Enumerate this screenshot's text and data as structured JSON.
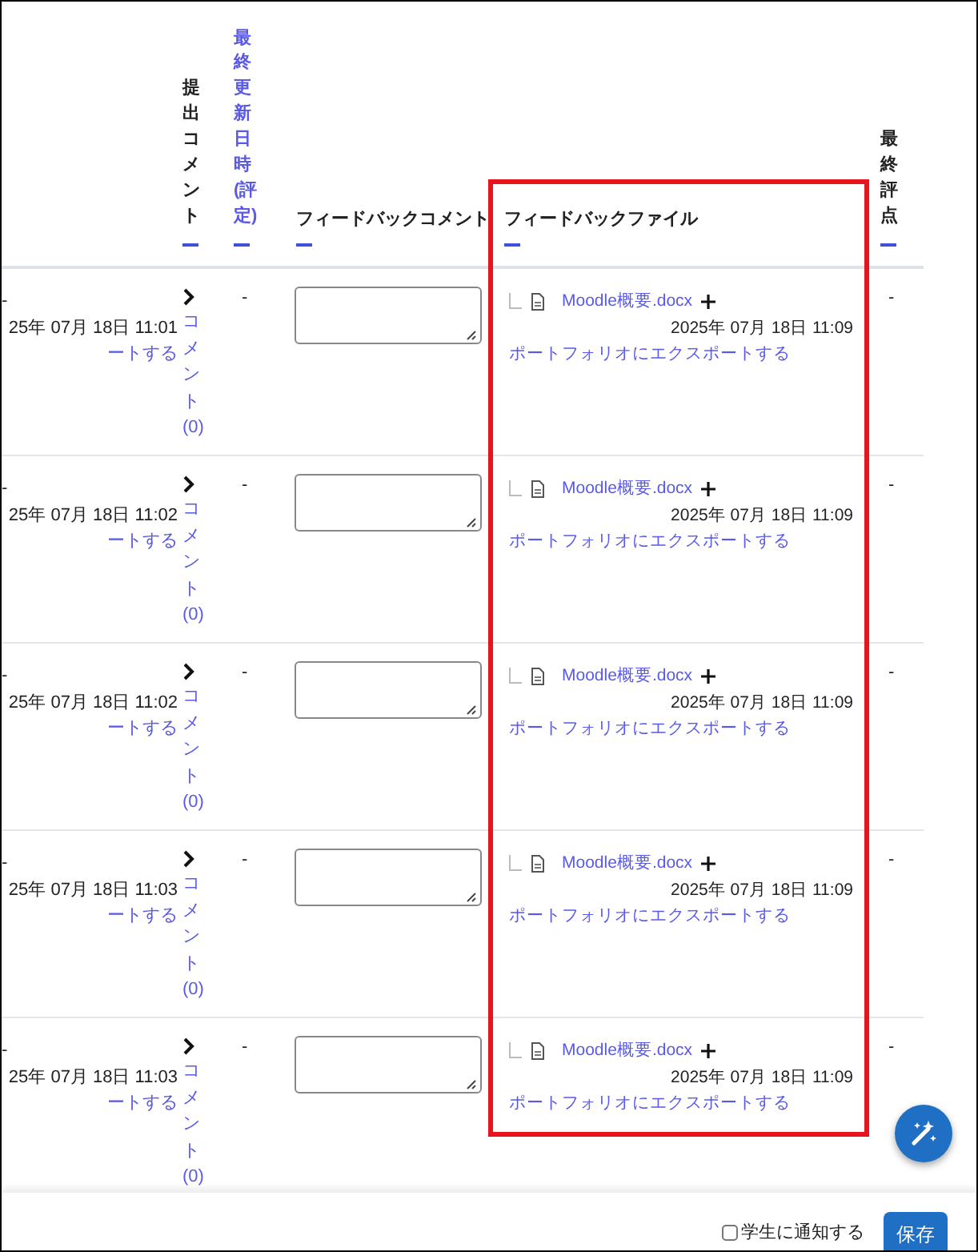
{
  "table": {
    "columns": [
      {
        "label": "提出コメント",
        "kind": "vertical",
        "link": false
      },
      {
        "label": "最終更新日時(評定)",
        "kind": "vertical",
        "link": true
      },
      {
        "label": "フィードバックコメント",
        "kind": "horizontal",
        "link": false
      },
      {
        "label": "フィードバックファイル",
        "kind": "horizontal",
        "link": false
      },
      {
        "label": "最終評点",
        "kind": "vertical",
        "link": false
      }
    ],
    "rows": [
      {
        "column_1": {
          "mark": "-",
          "date": "25年 07月 18日 11:01",
          "link": "ートする"
        },
        "comment": {
          "label": "コメント",
          "count": "(0)"
        },
        "modified": "-",
        "feedback_file": {
          "name": "Moodle概要.docx",
          "date": "2025年 07月 18日 11:09",
          "export": "ポートフォリオにエクスポートする"
        },
        "grade": "-"
      },
      {
        "column_1": {
          "mark": "-",
          "date": "25年 07月 18日 11:02",
          "link": "ートする"
        },
        "comment": {
          "label": "コメント",
          "count": "(0)"
        },
        "modified": "-",
        "feedback_file": {
          "name": "Moodle概要.docx",
          "date": "2025年 07月 18日 11:09",
          "export": "ポートフォリオにエクスポートする"
        },
        "grade": "-"
      },
      {
        "column_1": {
          "mark": "-",
          "date": "25年 07月 18日 11:02",
          "link": "ートする"
        },
        "comment": {
          "label": "コメント",
          "count": "(0)"
        },
        "modified": "-",
        "feedback_file": {
          "name": "Moodle概要.docx",
          "date": "2025年 07月 18日 11:09",
          "export": "ポートフォリオにエクスポートする"
        },
        "grade": "-"
      },
      {
        "column_1": {
          "mark": "-",
          "date": "25年 07月 18日 11:03",
          "link": "ートする"
        },
        "comment": {
          "label": "コメント",
          "count": "(0)"
        },
        "modified": "-",
        "feedback_file": {
          "name": "Moodle概要.docx",
          "date": "2025年 07月 18日 11:09",
          "export": "ポートフォリオにエクスポートする"
        },
        "grade": "-"
      },
      {
        "column_1": {
          "mark": "-",
          "date": "25年 07月 18日 11:03",
          "link": "ートする"
        },
        "comment": {
          "label": "コメント",
          "count": "(0)"
        },
        "modified": "-",
        "feedback_file": {
          "name": "Moodle概要.docx",
          "date": "2025年 07月 18日 11:09",
          "export": "ポートフォリオにエクスポートする"
        },
        "grade": "-"
      }
    ]
  },
  "footer": {
    "notify": {
      "label": "学生に通知する",
      "checked": false
    },
    "save_button": "保存"
  }
}
